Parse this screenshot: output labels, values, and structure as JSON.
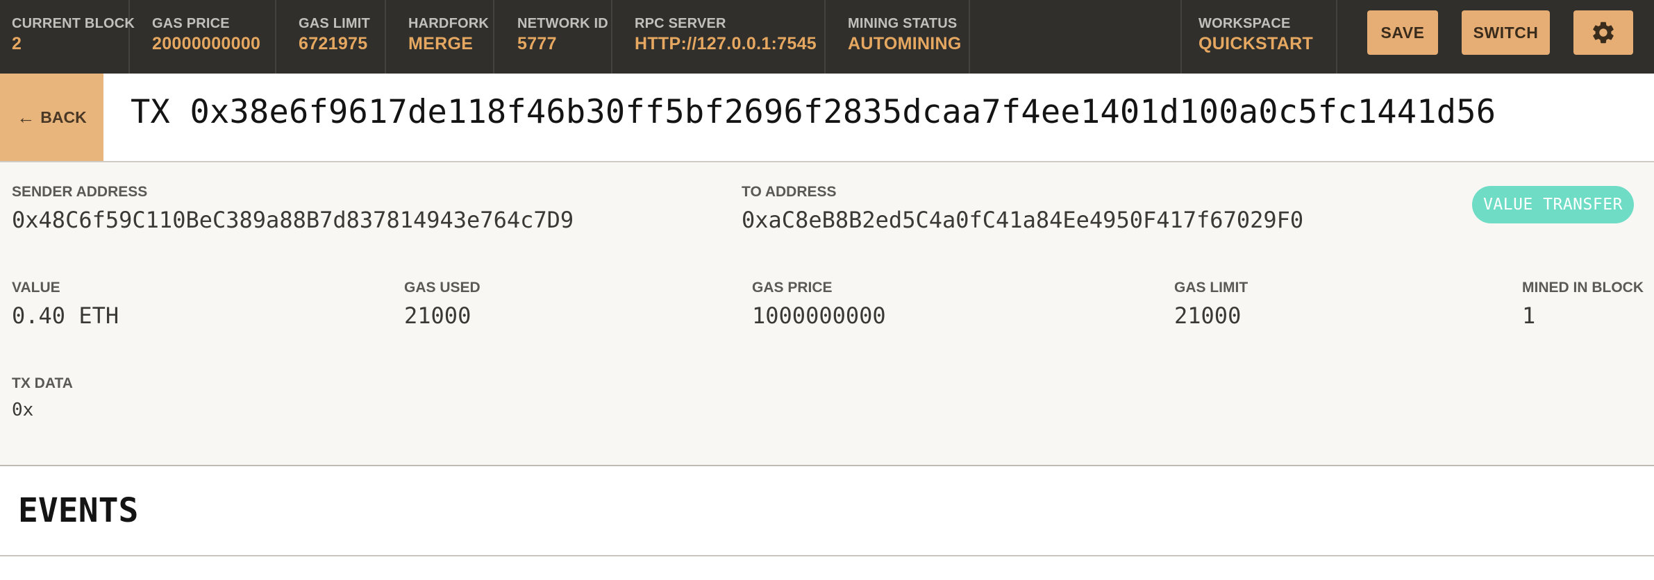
{
  "topbar": {
    "stats": [
      {
        "label": "CURRENT BLOCK",
        "value": "2"
      },
      {
        "label": "GAS PRICE",
        "value": "20000000000"
      },
      {
        "label": "GAS LIMIT",
        "value": "6721975"
      },
      {
        "label": "HARDFORK",
        "value": "MERGE"
      },
      {
        "label": "NETWORK ID",
        "value": "5777"
      },
      {
        "label": "RPC SERVER",
        "value": "HTTP://127.0.0.1:7545"
      },
      {
        "label": "MINING STATUS",
        "value": "AUTOMINING"
      }
    ],
    "workspace": {
      "label": "WORKSPACE",
      "value": "QUICKSTART"
    },
    "save_label": "SAVE",
    "switch_label": "SWITCH",
    "settings_icon": "gear-icon"
  },
  "header": {
    "back_label": "BACK",
    "back_icon": "arrow-left-icon",
    "tx_title": "TX 0x38e6f9617de118f46b30ff5bf2696f2835dcaa7f4ee1401d100a0c5fc1441d56"
  },
  "details": {
    "sender": {
      "label": "SENDER ADDRESS",
      "value": "0x48C6f59C110BeC389a88B7d837814943e764c7D9"
    },
    "to": {
      "label": "TO ADDRESS",
      "value": "0xaC8eB8B2ed5C4a0fC41a84Ee4950F417f67029F0"
    },
    "badge": "VALUE TRANSFER",
    "value": {
      "label": "VALUE",
      "value": "0.40 ETH"
    },
    "gas_used": {
      "label": "GAS USED",
      "value": "21000"
    },
    "gas_price": {
      "label": "GAS PRICE",
      "value": "1000000000"
    },
    "gas_limit": {
      "label": "GAS LIMIT",
      "value": "21000"
    },
    "mined_in_block": {
      "label": "MINED IN BLOCK",
      "value": "1"
    },
    "tx_data": {
      "label": "TX DATA",
      "value": "0x"
    }
  },
  "events": {
    "title": "EVENTS"
  },
  "colors": {
    "topbar_bg": "#302f2c",
    "accent": "#e6a861",
    "button_bg": "#e6ae74",
    "badge_bg": "#6fdcc5",
    "panel_bg": "#f8f7f4"
  }
}
